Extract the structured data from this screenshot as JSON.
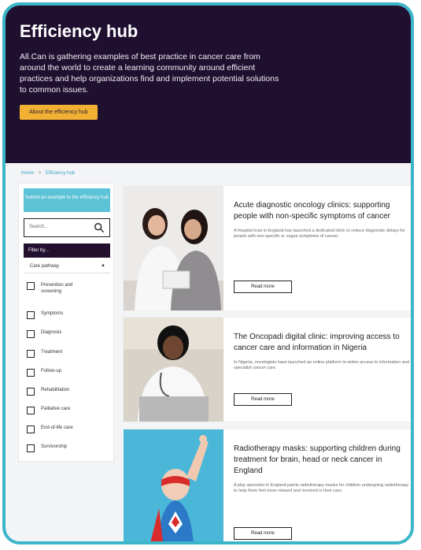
{
  "hero": {
    "title": "Efficiency hub",
    "description": "All.Can is gathering examples of best practice in cancer care from around the world to create a learning community around efficient practices and help organizations find and implement potential solutions to common issues.",
    "button_label": "About the efficiency hub"
  },
  "breadcrumb": {
    "home": "Home",
    "separator": ">",
    "current": "Efficiency hub"
  },
  "sidebar": {
    "submit_label": "Submit an example to the efficiency hub",
    "search_placeholder": "Search...",
    "filter_heading": "Filter by...",
    "select_label": "Care pathway",
    "options": [
      "Prevention and screening",
      "Symptoms",
      "Diagnosis",
      "Treatment",
      "Follow-up",
      "Rehabilitation",
      "Palliative care",
      "End-of-life care",
      "Survivorship"
    ]
  },
  "cards": [
    {
      "title": "Acute diagnostic oncology clinics: supporting people with non-specific symptoms of cancer",
      "description": "A hospital trust in England has launched a dedicated clinic to reduce diagnostic delays for people with non-specific or vague symptoms of cancer.",
      "button_label": "Read more"
    },
    {
      "title": "The Oncopadi digital clinic: improving access to cancer care and information in Nigeria",
      "description": "In Nigeria, oncologists have launched an online platform to widen access to information and specialist cancer care.",
      "button_label": "Read more"
    },
    {
      "title": "Radiotherapy masks: supporting children during treatment for brain, head or neck cancer in England",
      "description": "A play specialist in England paints radiotherapy masks for children undergoing radiotherapy to help them feel more relaxed and involved in their care.",
      "button_label": "Read more"
    }
  ],
  "colors": {
    "frame": "#3bb6c9",
    "hero_bg": "#1f1030",
    "accent_button": "#f2b132",
    "submit_button": "#5cc2d6"
  }
}
